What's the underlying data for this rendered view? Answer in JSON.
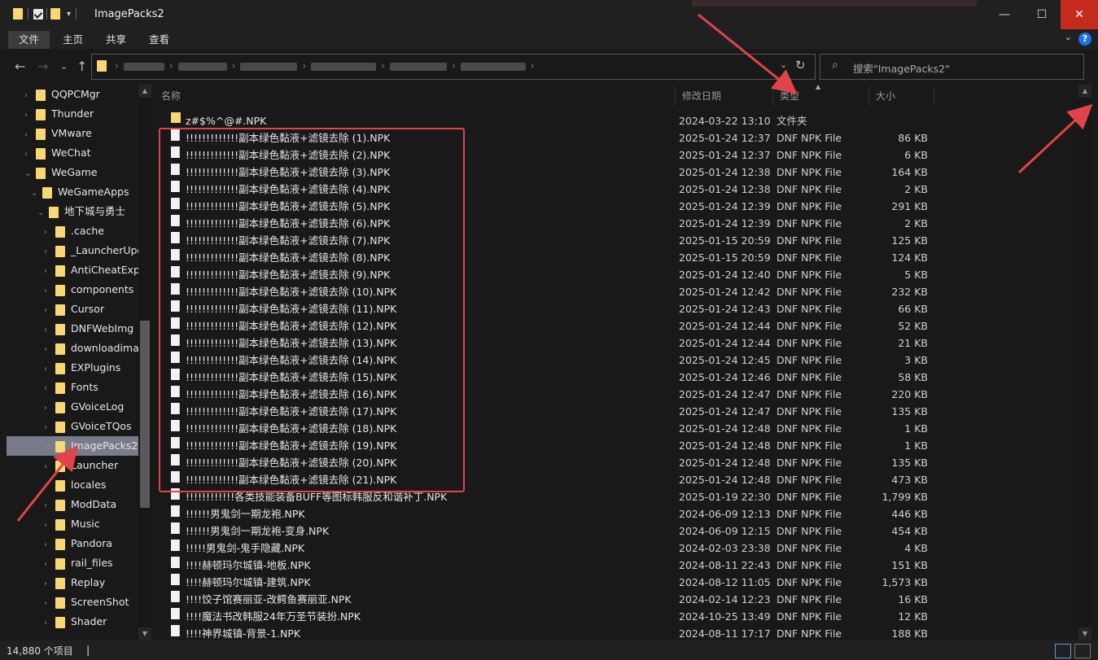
{
  "window": {
    "title": "ImagePacks2",
    "controls": {
      "minimize": "—",
      "maximize": "☐",
      "close": "✕"
    }
  },
  "ribbon": {
    "tabs": [
      "文件",
      "主页",
      "共享",
      "查看"
    ]
  },
  "address": {
    "search_placeholder": "搜索\"ImagePacks2\"",
    "refresh_icon": "refresh-icon",
    "dropdown_icon": "chevron-down-icon"
  },
  "tree": {
    "items": [
      {
        "label": "QQPCMgr",
        "level": 0
      },
      {
        "label": "Thunder",
        "level": 0
      },
      {
        "label": "VMware",
        "level": 0
      },
      {
        "label": "WeChat",
        "level": 0
      },
      {
        "label": "WeGame",
        "level": 0
      },
      {
        "label": "WeGameApps",
        "level": 1
      },
      {
        "label": "地下城与勇士",
        "level": 2
      },
      {
        "label": ".cache",
        "level": 3
      },
      {
        "label": "_LauncherUpo",
        "level": 3
      },
      {
        "label": "AntiCheatExp",
        "level": 3
      },
      {
        "label": "components",
        "level": 3
      },
      {
        "label": "Cursor",
        "level": 3
      },
      {
        "label": "DNFWebImg",
        "level": 3
      },
      {
        "label": "downloadima",
        "level": 3
      },
      {
        "label": "EXPlugins",
        "level": 3
      },
      {
        "label": "Fonts",
        "level": 3
      },
      {
        "label": "GVoiceLog",
        "level": 3
      },
      {
        "label": "GVoiceTQos",
        "level": 3
      },
      {
        "label": "ImagePacks2",
        "level": 3,
        "selected": true
      },
      {
        "label": "Launcher",
        "level": 3
      },
      {
        "label": "locales",
        "level": 3
      },
      {
        "label": "ModData",
        "level": 3
      },
      {
        "label": "Music",
        "level": 3
      },
      {
        "label": "Pandora",
        "level": 3
      },
      {
        "label": "rail_files",
        "level": 3
      },
      {
        "label": "Replay",
        "level": 3
      },
      {
        "label": "ScreenShot",
        "level": 3
      },
      {
        "label": "Shader",
        "level": 3
      }
    ]
  },
  "columns": {
    "name": "名称",
    "date": "修改日期",
    "type": "类型",
    "size": "大小"
  },
  "files": [
    {
      "name": "z#$%^@#.NPK",
      "date": "2024-03-22 13:10",
      "type": "文件夹",
      "size": "",
      "folder": true
    },
    {
      "name": "!!!!!!!!!!!!!副本绿色黏液+滤镜去除 (1).NPK",
      "date": "2025-01-24 12:37",
      "type": "DNF NPK File",
      "size": "86 KB"
    },
    {
      "name": "!!!!!!!!!!!!!副本绿色黏液+滤镜去除 (2).NPK",
      "date": "2025-01-24 12:37",
      "type": "DNF NPK File",
      "size": "6 KB"
    },
    {
      "name": "!!!!!!!!!!!!!副本绿色黏液+滤镜去除 (3).NPK",
      "date": "2025-01-24 12:38",
      "type": "DNF NPK File",
      "size": "164 KB"
    },
    {
      "name": "!!!!!!!!!!!!!副本绿色黏液+滤镜去除 (4).NPK",
      "date": "2025-01-24 12:38",
      "type": "DNF NPK File",
      "size": "2 KB"
    },
    {
      "name": "!!!!!!!!!!!!!副本绿色黏液+滤镜去除 (5).NPK",
      "date": "2025-01-24 12:39",
      "type": "DNF NPK File",
      "size": "291 KB"
    },
    {
      "name": "!!!!!!!!!!!!!副本绿色黏液+滤镜去除 (6).NPK",
      "date": "2025-01-24 12:39",
      "type": "DNF NPK File",
      "size": "2 KB"
    },
    {
      "name": "!!!!!!!!!!!!!副本绿色黏液+滤镜去除 (7).NPK",
      "date": "2025-01-15 20:59",
      "type": "DNF NPK File",
      "size": "125 KB"
    },
    {
      "name": "!!!!!!!!!!!!!副本绿色黏液+滤镜去除 (8).NPK",
      "date": "2025-01-15 20:59",
      "type": "DNF NPK File",
      "size": "124 KB"
    },
    {
      "name": "!!!!!!!!!!!!!副本绿色黏液+滤镜去除 (9).NPK",
      "date": "2025-01-24 12:40",
      "type": "DNF NPK File",
      "size": "5 KB"
    },
    {
      "name": "!!!!!!!!!!!!!副本绿色黏液+滤镜去除 (10).NPK",
      "date": "2025-01-24 12:42",
      "type": "DNF NPK File",
      "size": "232 KB"
    },
    {
      "name": "!!!!!!!!!!!!!副本绿色黏液+滤镜去除 (11).NPK",
      "date": "2025-01-24 12:43",
      "type": "DNF NPK File",
      "size": "66 KB"
    },
    {
      "name": "!!!!!!!!!!!!!副本绿色黏液+滤镜去除 (12).NPK",
      "date": "2025-01-24 12:44",
      "type": "DNF NPK File",
      "size": "52 KB"
    },
    {
      "name": "!!!!!!!!!!!!!副本绿色黏液+滤镜去除 (13).NPK",
      "date": "2025-01-24 12:44",
      "type": "DNF NPK File",
      "size": "21 KB"
    },
    {
      "name": "!!!!!!!!!!!!!副本绿色黏液+滤镜去除 (14).NPK",
      "date": "2025-01-24 12:45",
      "type": "DNF NPK File",
      "size": "3 KB"
    },
    {
      "name": "!!!!!!!!!!!!!副本绿色黏液+滤镜去除 (15).NPK",
      "date": "2025-01-24 12:46",
      "type": "DNF NPK File",
      "size": "58 KB"
    },
    {
      "name": "!!!!!!!!!!!!!副本绿色黏液+滤镜去除 (16).NPK",
      "date": "2025-01-24 12:47",
      "type": "DNF NPK File",
      "size": "220 KB"
    },
    {
      "name": "!!!!!!!!!!!!!副本绿色黏液+滤镜去除 (17).NPK",
      "date": "2025-01-24 12:47",
      "type": "DNF NPK File",
      "size": "135 KB"
    },
    {
      "name": "!!!!!!!!!!!!!副本绿色黏液+滤镜去除 (18).NPK",
      "date": "2025-01-24 12:48",
      "type": "DNF NPK File",
      "size": "1 KB"
    },
    {
      "name": "!!!!!!!!!!!!!副本绿色黏液+滤镜去除 (19).NPK",
      "date": "2025-01-24 12:48",
      "type": "DNF NPK File",
      "size": "1 KB"
    },
    {
      "name": "!!!!!!!!!!!!!副本绿色黏液+滤镜去除 (20).NPK",
      "date": "2025-01-24 12:48",
      "type": "DNF NPK File",
      "size": "135 KB"
    },
    {
      "name": "!!!!!!!!!!!!!副本绿色黏液+滤镜去除 (21).NPK",
      "date": "2025-01-24 12:48",
      "type": "DNF NPK File",
      "size": "473 KB"
    },
    {
      "name": "!!!!!!!!!!!!各类技能装备BUFF等图标韩服反和谐补丁.NPK",
      "date": "2025-01-19 22:30",
      "type": "DNF NPK File",
      "size": "1,799 KB"
    },
    {
      "name": "!!!!!!男鬼剑一期龙袍.NPK",
      "date": "2024-06-09 12:13",
      "type": "DNF NPK File",
      "size": "446 KB"
    },
    {
      "name": "!!!!!!男鬼剑一期龙袍-变身.NPK",
      "date": "2024-06-09 12:15",
      "type": "DNF NPK File",
      "size": "454 KB"
    },
    {
      "name": "!!!!!男鬼剑-鬼手隐藏.NPK",
      "date": "2024-02-03 23:38",
      "type": "DNF NPK File",
      "size": "4 KB"
    },
    {
      "name": "!!!!赫顿玛尔城镇-地板.NPK",
      "date": "2024-08-11 22:43",
      "type": "DNF NPK File",
      "size": "151 KB"
    },
    {
      "name": "!!!!赫顿玛尔城镇-建筑.NPK",
      "date": "2024-08-12 11:05",
      "type": "DNF NPK File",
      "size": "1,573 KB"
    },
    {
      "name": "!!!!饺子馆赛丽亚-改鳄鱼赛丽亚.NPK",
      "date": "2024-02-14 12:23",
      "type": "DNF NPK File",
      "size": "16 KB"
    },
    {
      "name": "!!!!魔法书改韩服24年万圣节装扮.NPK",
      "date": "2024-10-25 13:49",
      "type": "DNF NPK File",
      "size": "12 KB"
    },
    {
      "name": "!!!!神界城镇-背景-1.NPK",
      "date": "2024-08-11 17:17",
      "type": "DNF NPK File",
      "size": "188 KB"
    }
  ],
  "status": {
    "count": "14,880 个项目",
    "divider": "|"
  },
  "colors": {
    "annotation": "#e0444a",
    "folder": "#f8d775",
    "selected": "#777b8a"
  }
}
